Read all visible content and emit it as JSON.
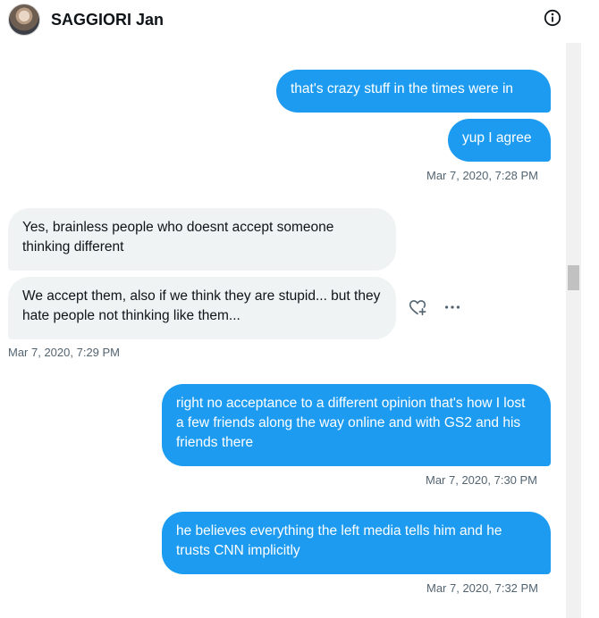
{
  "conversation": {
    "user_name": "SAGGIORI Jan",
    "info_icon": "info-icon",
    "avatar_icon": "user-avatar"
  },
  "messages": [
    {
      "direction": "sent",
      "text": "that's crazy stuff in the times were in"
    },
    {
      "direction": "sent",
      "text": "yup I agree"
    },
    {
      "direction": "timestamp",
      "text": "Mar 7, 2020, 7:28 PM"
    },
    {
      "direction": "received",
      "text": "Yes, brainless people who doesnt accept someone thinking different"
    },
    {
      "direction": "received",
      "text": "We accept them, also if we think they are stupid... but they hate people not thinking like them..."
    },
    {
      "direction": "timestamp",
      "text": "Mar 7, 2020, 7:29 PM"
    },
    {
      "direction": "sent",
      "text": "right no acceptance to a different opinion that's how I lost a few friends along the way online and with GS2 and his friends there"
    },
    {
      "direction": "timestamp",
      "text": "Mar 7, 2020, 7:30 PM"
    },
    {
      "direction": "sent",
      "text": "he believes everything the left media tells him and he trusts CNN implicitly"
    },
    {
      "direction": "timestamp",
      "text": "Mar 7, 2020, 7:32 PM"
    }
  ],
  "hover_actions": {
    "react_icon": "heart-plus-icon",
    "more_icon": "more-icon"
  },
  "colors": {
    "sent_bubble": "#1d9bf0",
    "received_bubble": "#eff3f4",
    "timestamp_text": "#536471"
  }
}
